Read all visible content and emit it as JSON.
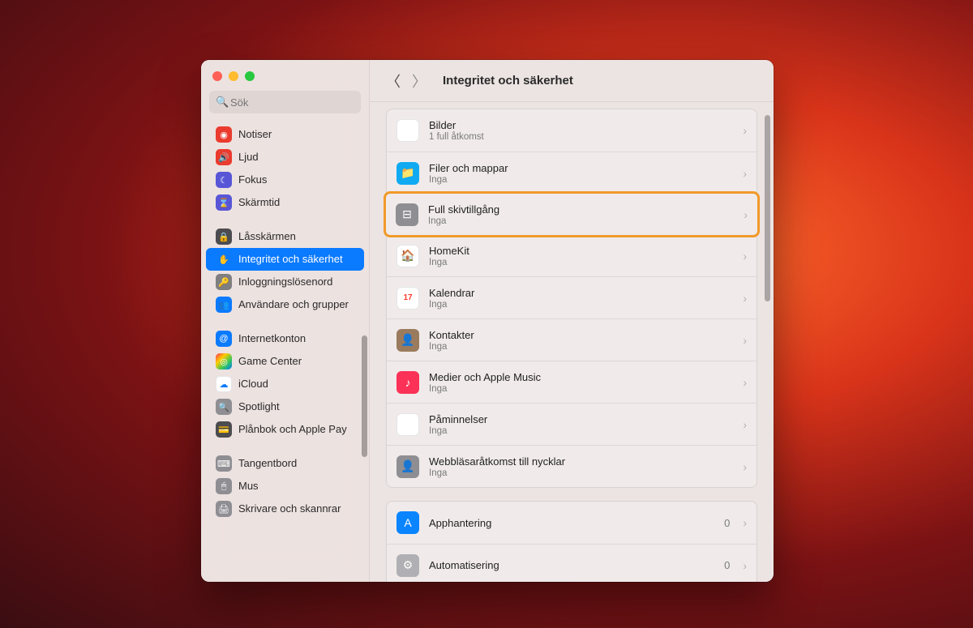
{
  "window": {
    "title": "Integritet och säkerhet",
    "search_placeholder": "Sök"
  },
  "sidebar": {
    "groups": [
      [
        {
          "label": "Notiser",
          "icon": "bell-icon",
          "bg": "sb-red",
          "glyph": "◉"
        },
        {
          "label": "Ljud",
          "icon": "sound-icon",
          "bg": "sb-red2",
          "glyph": "🔊"
        },
        {
          "label": "Fokus",
          "icon": "moon-icon",
          "bg": "sb-purple",
          "glyph": "☾"
        },
        {
          "label": "Skärmtid",
          "icon": "hourglass-icon",
          "bg": "sb-purple",
          "glyph": "⌛"
        }
      ],
      [
        {
          "label": "Låsskärmen",
          "icon": "lock-icon",
          "bg": "sb-dark",
          "glyph": "🔒"
        },
        {
          "label": "Integritet och säkerhet",
          "icon": "hand-icon",
          "bg": "sb-blue",
          "glyph": "✋",
          "selected": true
        },
        {
          "label": "Inloggningslösenord",
          "icon": "key-icon",
          "bg": "sb-gray",
          "glyph": "🔑"
        },
        {
          "label": "Användare och grupper",
          "icon": "users-icon",
          "bg": "sb-blue",
          "glyph": "👥"
        }
      ],
      [
        {
          "label": "Internetkonton",
          "icon": "at-icon",
          "bg": "sb-blue",
          "glyph": "@"
        },
        {
          "label": "Game Center",
          "icon": "gamecenter-icon",
          "bg": "sb-multi",
          "glyph": "◎"
        },
        {
          "label": "iCloud",
          "icon": "cloud-icon",
          "bg": "sb-white",
          "glyph": "☁"
        },
        {
          "label": "Spotlight",
          "icon": "spotlight-icon",
          "bg": "sb-gray2",
          "glyph": "🔍"
        },
        {
          "label": "Plånbok och Apple Pay",
          "icon": "wallet-icon",
          "bg": "sb-dark",
          "glyph": "💳"
        }
      ],
      [
        {
          "label": "Tangentbord",
          "icon": "keyboard-icon",
          "bg": "sb-gray2",
          "glyph": "⌨"
        },
        {
          "label": "Mus",
          "icon": "mouse-icon",
          "bg": "sb-gray2",
          "glyph": "🖱"
        },
        {
          "label": "Skrivare och skannrar",
          "icon": "printer-icon",
          "bg": "sb-gray2",
          "glyph": "🖨"
        }
      ]
    ]
  },
  "main": {
    "panels": [
      {
        "rows": [
          {
            "icon": "photos-icon",
            "iconClass": "ri-photos",
            "glyph": "✿",
            "title": "Bilder",
            "sub": "1 full åtkomst"
          },
          {
            "icon": "folder-icon",
            "iconClass": "ri-folder",
            "glyph": "📁",
            "title": "Filer och mappar",
            "sub": "Inga"
          },
          {
            "icon": "disk-icon",
            "iconClass": "ri-disk",
            "glyph": "⊟",
            "title": "Full skivtillgång",
            "sub": "Inga",
            "highlight": true
          },
          {
            "icon": "home-icon",
            "iconClass": "ri-home",
            "glyph": "🏠",
            "title": "HomeKit",
            "sub": "Inga"
          },
          {
            "icon": "calendar-icon",
            "iconClass": "ri-cal",
            "glyph": "17",
            "title": "Kalendrar",
            "sub": "Inga"
          },
          {
            "icon": "contacts-icon",
            "iconClass": "ri-contacts",
            "glyph": "👤",
            "title": "Kontakter",
            "sub": "Inga"
          },
          {
            "icon": "music-icon",
            "iconClass": "ri-music",
            "glyph": "♪",
            "title": "Medier och Apple Music",
            "sub": "Inga"
          },
          {
            "icon": "reminders-icon",
            "iconClass": "ri-remind",
            "glyph": "≡",
            "title": "Påminnelser",
            "sub": "Inga"
          },
          {
            "icon": "webkey-icon",
            "iconClass": "ri-webkey",
            "glyph": "👤",
            "title": "Webbläsaråtkomst till nycklar",
            "sub": "Inga"
          }
        ]
      },
      {
        "rows": [
          {
            "icon": "app-icon",
            "iconClass": "ri-app",
            "glyph": "A",
            "title": "Apphantering",
            "count": "0"
          },
          {
            "icon": "automation-icon",
            "iconClass": "ri-auto",
            "glyph": "⚙",
            "title": "Automatisering",
            "count": "0"
          }
        ]
      }
    ]
  }
}
